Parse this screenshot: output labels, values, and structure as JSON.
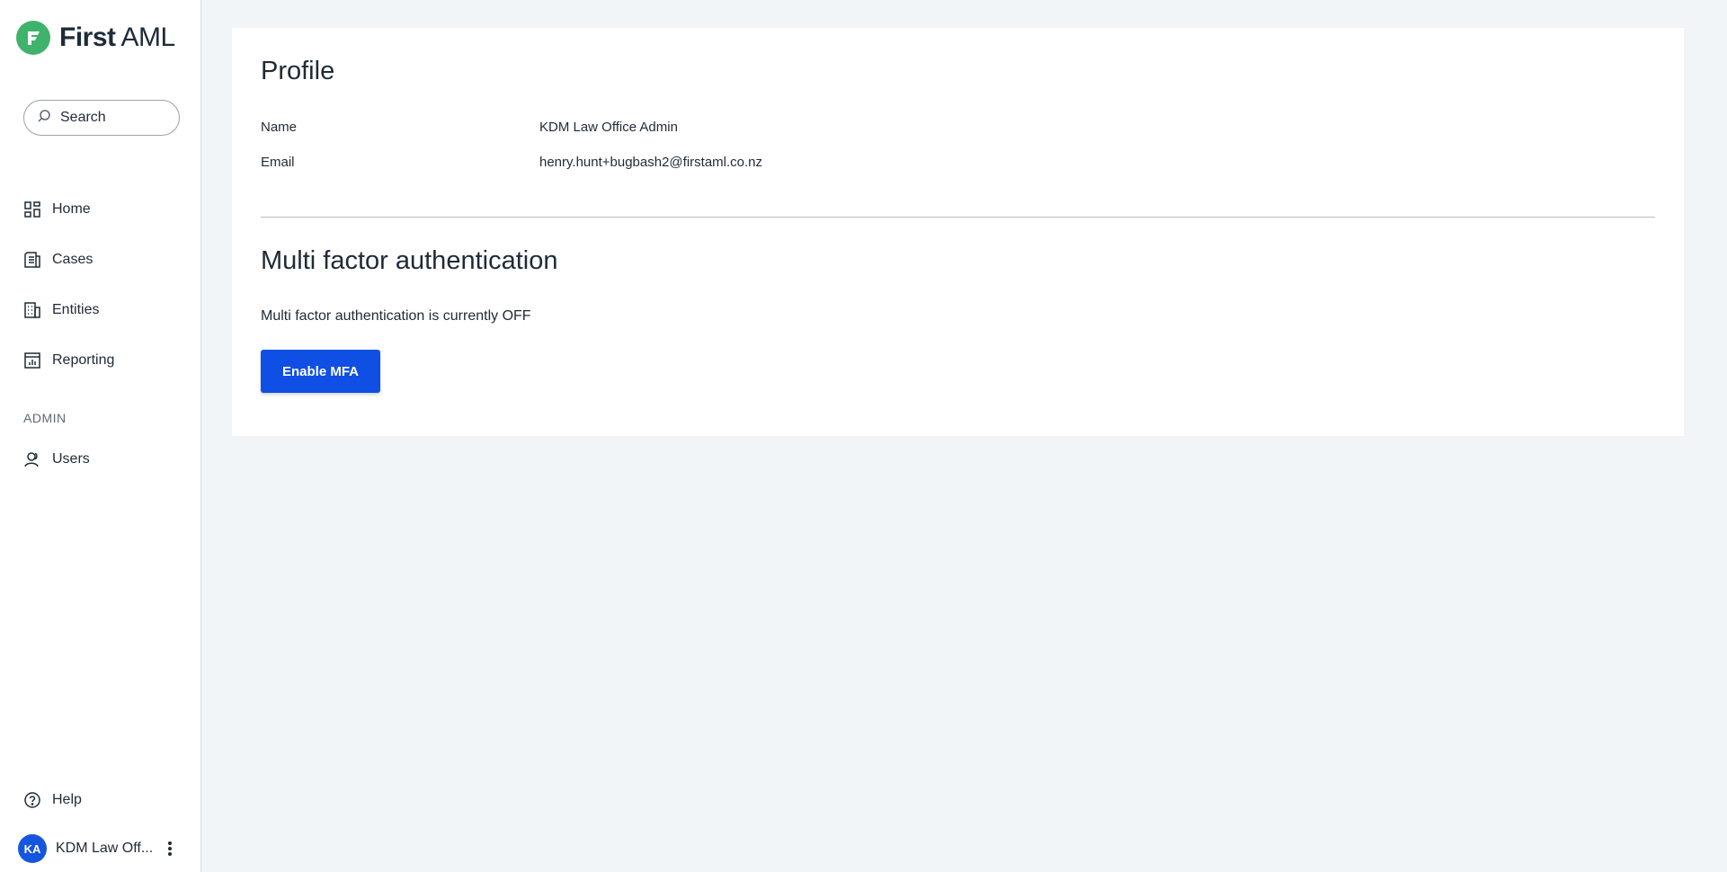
{
  "brand": {
    "name_bold": "First",
    "name_light": "AML",
    "color": "#3fb36b"
  },
  "search": {
    "placeholder": "Search",
    "value": ""
  },
  "nav": {
    "items": [
      {
        "label": "Home",
        "icon": "dashboard-icon"
      },
      {
        "label": "Cases",
        "icon": "document-list-icon"
      },
      {
        "label": "Entities",
        "icon": "building-icon"
      },
      {
        "label": "Reporting",
        "icon": "bar-chart-icon"
      }
    ],
    "admin_label": "ADMIN",
    "admin_items": [
      {
        "label": "Users",
        "icon": "user-icon"
      }
    ],
    "help_label": "Help"
  },
  "user": {
    "initials": "KA",
    "name": "KDM Law Off...",
    "avatar_color": "#1556e0"
  },
  "profile": {
    "title": "Profile",
    "fields": [
      {
        "label": "Name",
        "value": "KDM Law Office Admin"
      },
      {
        "label": "Email",
        "value": "henry.hunt+bugbash2@firstaml.co.nz"
      }
    ]
  },
  "mfa": {
    "title": "Multi factor authentication",
    "status_text": "Multi factor authentication is currently OFF",
    "button_label": "Enable MFA",
    "button_color": "#0f4fe4"
  }
}
